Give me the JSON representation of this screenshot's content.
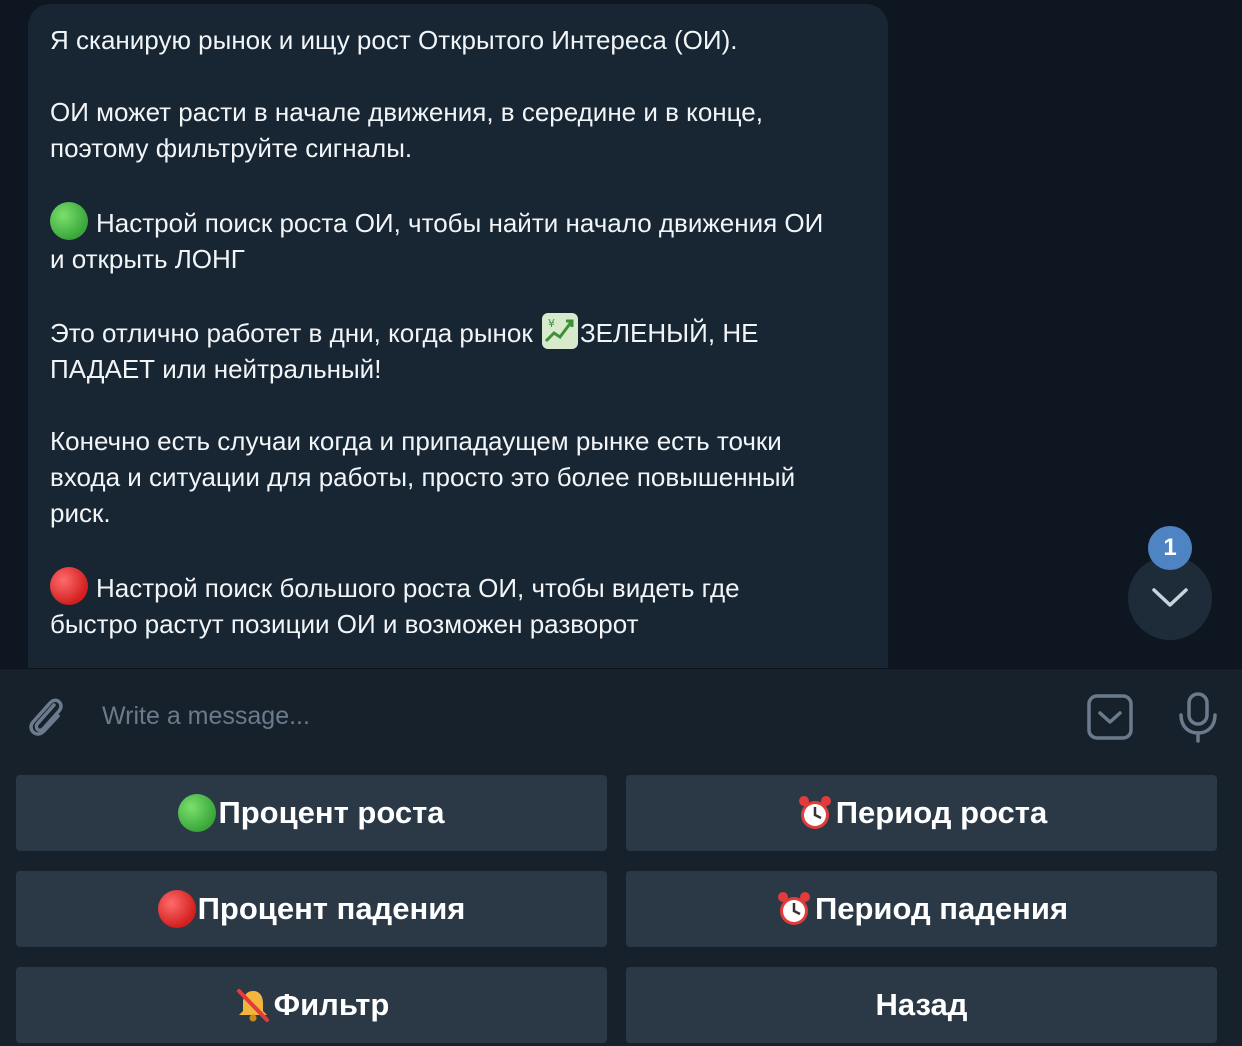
{
  "message": {
    "paragraphs": [
      {
        "text": "Я сканирую рынок и ищу рост Открытого Интереса (ОИ)."
      },
      {
        "text": "ОИ может расти в начале движения, в середине и в конце,\nпоэтому фильтруйте сигналы."
      },
      {
        "prefix_icon": "green-circle-emoji",
        "text": "Настрой поиск роста ОИ, чтобы найти начало движения ОИ\nи открыть ЛОНГ"
      },
      {
        "text_before": "Это отлично работет в дни, когда рынок ",
        "inline_icon": "chart-yen-emoji",
        "text_after": "ЗЕЛЕНЫЙ, НЕ\nПАДАЕТ или нейтральный!"
      },
      {
        "text": "Конечно есть случаи когда и припадаущем рынке есть точки\nвхода и ситуации для работы, просто это более повышенный\nриск."
      },
      {
        "prefix_icon": "red-circle-emoji",
        "text": "Настрой поиск большого роста ОИ, чтобы видеть где\nбыстро растут позиции ОИ и возможен разворот"
      }
    ]
  },
  "scroll_down": {
    "unread_count": "1",
    "icon": "chevron-down-icon"
  },
  "composer": {
    "placeholder": "Write a message...",
    "attach_icon": "paperclip-icon",
    "keyboard_icon": "keyboard-toggle-icon",
    "mic_icon": "microphone-icon"
  },
  "keyboard": {
    "buttons": [
      {
        "id": "growth-percent",
        "icon": "green-circle-emoji",
        "label": "Процент роста"
      },
      {
        "id": "growth-period",
        "icon": "alarm-clock-emoji",
        "label": "Период роста"
      },
      {
        "id": "fall-percent",
        "icon": "red-circle-emoji",
        "label": "Процент падения"
      },
      {
        "id": "fall-period",
        "icon": "alarm-clock-emoji",
        "label": "Период падения"
      },
      {
        "id": "filter",
        "icon": "muted-bell-emoji",
        "label": "Фильтр"
      },
      {
        "id": "back",
        "icon": "",
        "label": "Назад"
      }
    ]
  },
  "colors": {
    "background": "#0e1621",
    "bubble": "#182533",
    "composer": "#17212b",
    "keyboard_button": "#2b3947",
    "badge": "#4e84c4",
    "placeholder": "#6b7b8c"
  }
}
